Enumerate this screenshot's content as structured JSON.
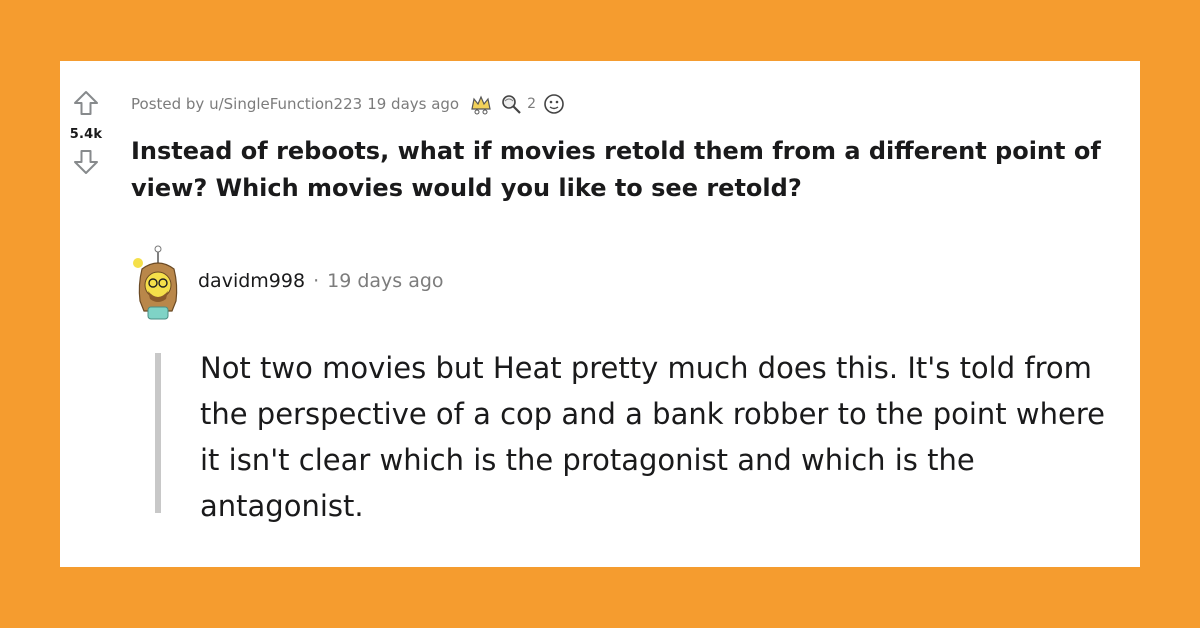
{
  "post": {
    "upvote_icon": "upvote-arrow-icon",
    "downvote_icon": "downvote-arrow-icon",
    "score": "5.4k",
    "posted_by": "Posted by u/SingleFunction223",
    "posted_time": "19 days ago",
    "award_count": "2",
    "award_icons": [
      "crown-award-icon",
      "magnifier-award-icon",
      "face-award-icon"
    ],
    "title": "Instead of reboots, what if movies retold them from a different point of view? Which movies would you like to see retold?"
  },
  "comment": {
    "avatar_icon": "snoo-avatar-icon",
    "username": "davidm998",
    "separator": "·",
    "time": "19 days ago",
    "body": "Not two movies but Heat pretty much does this. It's told from the perspective of a cop and a bank robber to the point where it isn't clear which is the protagonist and which is the antagonist."
  },
  "colors": {
    "background": "#F59C2F",
    "card": "#FFFFFF",
    "text": "#1A1A1B",
    "meta": "#7C7C7C",
    "thread_line": "#C8C8C8"
  }
}
